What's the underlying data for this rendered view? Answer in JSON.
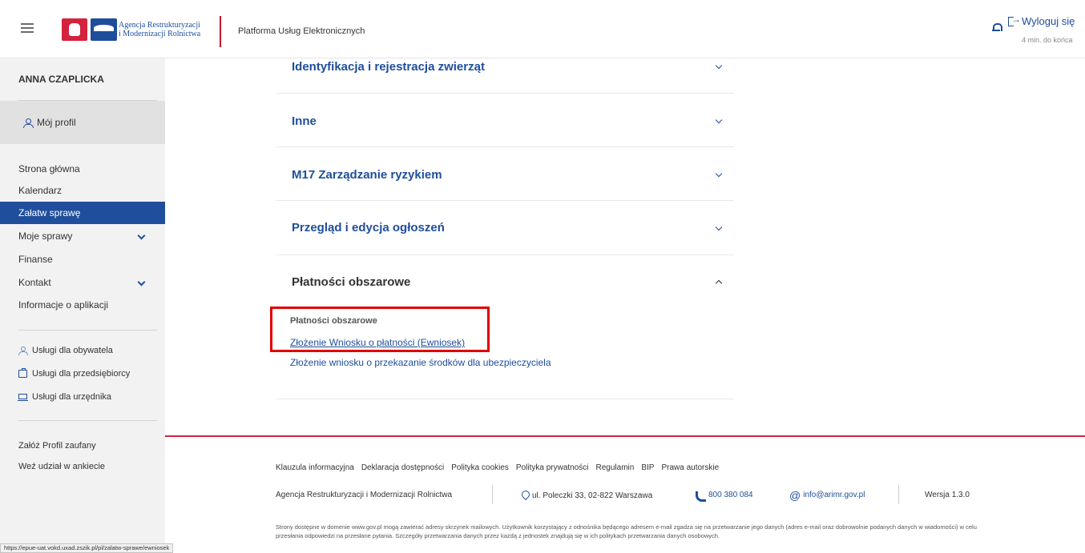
{
  "header": {
    "logo_text_line1": "Agencja Restrukturyzacji",
    "logo_text_line2": "i Modernizacji Rolnictwa",
    "platform_title": "Platforma Usług Elektronicznych",
    "logout_label": "Wyloguj się",
    "session_time": "4 min. do końca",
    "icons": [
      "menu-icon",
      "bell-icon",
      "logout-icon"
    ]
  },
  "sidebar": {
    "user_name": "ANNA CZAPLICKA",
    "profile_label": "Mój profil",
    "nav": [
      {
        "label": "Strona główna"
      },
      {
        "label": "Kalendarz"
      },
      {
        "label": "Załatw sprawę",
        "active": true
      },
      {
        "label": "Moje sprawy",
        "expandable": true
      },
      {
        "label": "Finanse"
      },
      {
        "label": "Kontakt",
        "expandable": true
      },
      {
        "label": "Informacje o aplikacji"
      }
    ],
    "services": [
      {
        "label": "Usługi dla obywatela",
        "icon": "person-icon"
      },
      {
        "label": "Usługi dla przedsiębiorcy",
        "icon": "briefcase-icon"
      },
      {
        "label": "Usługi dla urzędnika",
        "icon": "laptop-icon"
      }
    ],
    "extra": [
      {
        "label": "Załóż Profil zaufany"
      },
      {
        "label": "Weź udział w ankiecie"
      }
    ]
  },
  "main": {
    "accordion": [
      {
        "title": "Identyfikacja i rejestracja zwierząt",
        "expanded": false
      },
      {
        "title": "Inne",
        "expanded": false
      },
      {
        "title": "M17 Zarządzanie ryzykiem",
        "expanded": false
      },
      {
        "title": "Przegląd i edycja ogłoszeń",
        "expanded": false
      },
      {
        "title": "Płatności obszarowe",
        "expanded": true
      }
    ],
    "expanded_section": {
      "header": "Płatności obszarowe",
      "links": [
        "Złożenie Wniosku o płatności (Ewniosek)",
        "Złożenie wniosku o przekazanie środków dla ubezpieczyciela"
      ]
    },
    "highlight_color": "#e00000"
  },
  "footer": {
    "links": [
      "Klauzula informacyjna",
      "Deklaracja dostępności",
      "Polityka cookies",
      "Polityka prywatności",
      "Regulamin",
      "BIP",
      "Prawa autorskie"
    ],
    "org_name": "Agencja Restrukturyzacji i Modernizacji Rolnictwa",
    "address": "ul. Poleczki 33, 02-822 Warszawa",
    "phone": "800 380 084",
    "email": "info@arimr.gov.pl",
    "version": "Wersja 1.3.0",
    "disclaimer": "Strony dostępne w domenie www.gov.pl mogą zawierać adresy skrzynek mailowych. Użytkownik korzystający z odnośnika będącego adresem e-mail zgadza się na przetwarzanie jego danych (adres e-mail oraz dobrowolnie podanych danych w wiadomości) w celu przesłania odpowiedzi na przesłane pytania. Szczegóły przetwarzania danych przez każdą z jednostek znajdują się w ich politykach przetwarzania danych osobowych."
  },
  "status_bar": {
    "url": "https://epue-uat.vokd.uxad.zszik.pl/pl/zalatw-sprawe/ewniosek"
  },
  "colors": {
    "primary_blue": "#1f4e9c",
    "accent_red": "#d4213d",
    "sidebar_bg": "#f2f2f2"
  }
}
